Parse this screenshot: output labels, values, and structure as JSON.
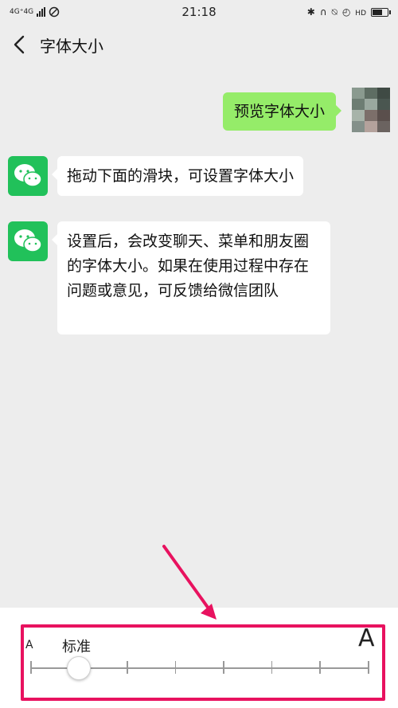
{
  "status_bar": {
    "network": "4G⁺4G",
    "time": "21:18",
    "right_icons": [
      "bluetooth-icon",
      "headset-icon",
      "mute-icon",
      "alarm-icon",
      "call-hd-icon",
      "battery-icon"
    ],
    "hd_label": "HD"
  },
  "nav": {
    "title": "字体大小",
    "back_icon": "back-chevron-icon"
  },
  "messages": [
    {
      "side": "right",
      "text": "预览字体大小"
    },
    {
      "side": "left",
      "text": "拖动下面的滑块，可设置字体大小"
    },
    {
      "side": "left",
      "text": "设置后，会改变聊天、菜单和朋友圈的字体大小。如果在使用过程中存在问题或意见，可反馈给微信团队"
    }
  ],
  "font_slider": {
    "small_label": "A",
    "large_label": "A",
    "current_label": "标准",
    "steps": 8,
    "selected_index": 1
  },
  "colors": {
    "accent_green": "#21c15a",
    "bubble_green": "#95ec69",
    "annotation": "#e8125f"
  }
}
